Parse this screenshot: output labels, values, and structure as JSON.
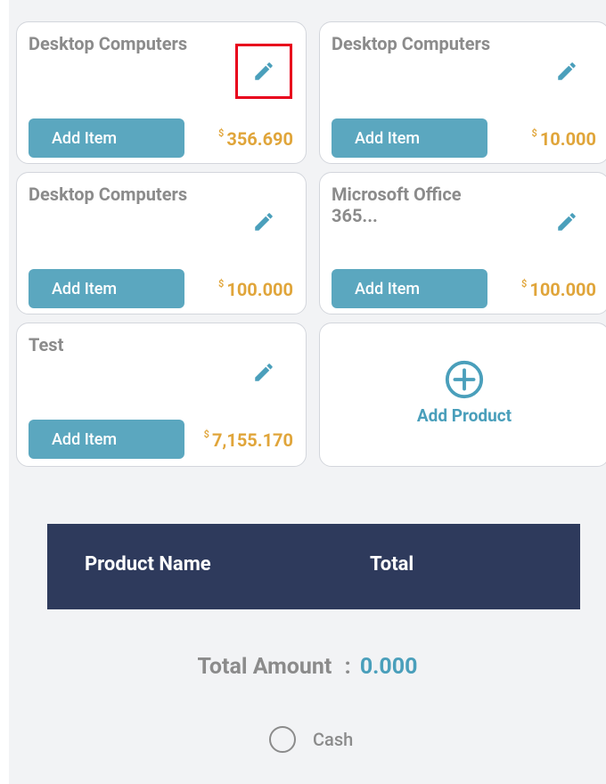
{
  "products": [
    {
      "title": "Desktop Computers",
      "add_label": "Add Item",
      "currency": "$",
      "price": "356.690"
    },
    {
      "title": "Desktop Computers",
      "add_label": "Add Item",
      "currency": "$",
      "price": "10.000"
    },
    {
      "title": "Desktop Computers",
      "add_label": "Add Item",
      "currency": "$",
      "price": "100.000"
    },
    {
      "title": "Microsoft Office 365...",
      "add_label": "Add Item",
      "currency": "$",
      "price": "100.000"
    },
    {
      "title": "Test",
      "add_label": "Add Item",
      "currency": "$",
      "price": "7,155.170"
    }
  ],
  "add_product": {
    "label": "Add Product",
    "icon": "plus-circle-icon"
  },
  "table": {
    "col_product": "Product Name",
    "col_total": "Total"
  },
  "total": {
    "label": "Total Amount",
    "separator": ":",
    "value": "0.000"
  },
  "payment": {
    "cash_label": "Cash"
  },
  "colors": {
    "accent": "#5ba7bf",
    "price": "#e0a53a",
    "header_bg": "#2e3a5c",
    "highlight": "#e8001c"
  }
}
